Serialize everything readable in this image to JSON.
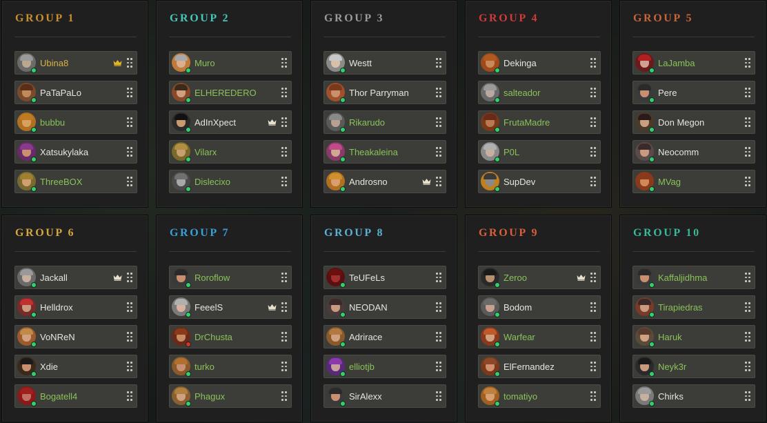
{
  "colors": {
    "owner": "#d4a640",
    "member": "#8ac25a",
    "other": "#e6e6e0",
    "online": "#2fd36d",
    "offline": "#d8322b",
    "crown": "#e6d8a8"
  },
  "groups": [
    {
      "title": "GROUP 1",
      "color": "#c98f2e",
      "players": [
        {
          "name": "Ubina8",
          "nameColor": "#d9b24a",
          "crown": true,
          "crownColor": "#e3b52a",
          "status": "online",
          "skin": "#b8a890",
          "hair": "#9a9a9a",
          "bg": "#6b6b6b"
        },
        {
          "name": "PaTaPaLo",
          "nameColor": "#e6e6e0",
          "crown": false,
          "status": "online",
          "skin": "#c08a5a",
          "hair": "#5a2f1a",
          "bg": "#7a4a2a"
        },
        {
          "name": "bubbu",
          "nameColor": "#8ac25a",
          "crown": false,
          "status": "online",
          "skin": "#d8a060",
          "hair": "#c07a20",
          "bg": "#b07020"
        },
        {
          "name": "Xatsukylaka",
          "nameColor": "#e6e6e0",
          "crown": false,
          "status": "online",
          "skin": "#c89070",
          "hair": "#8a3a8a",
          "bg": "#6a2a6a"
        },
        {
          "name": "ThreeBOX",
          "nameColor": "#8ac25a",
          "crown": false,
          "status": "online",
          "skin": "#d0a070",
          "hair": "#a08030",
          "bg": "#7a6a30"
        }
      ]
    },
    {
      "title": "GROUP 2",
      "color": "#47c7b8",
      "players": [
        {
          "name": "Muro",
          "nameColor": "#8ac25a",
          "crown": false,
          "status": "online",
          "skin": "#d8b090",
          "hair": "#a8a8a8",
          "bg": "#c07a3a"
        },
        {
          "name": "ELHEREDERO",
          "nameColor": "#8ac25a",
          "crown": false,
          "status": "online",
          "skin": "#d0a080",
          "hair": "#3a2a1a",
          "bg": "#8a4a2a"
        },
        {
          "name": "AdInXpect",
          "nameColor": "#e6e6e0",
          "crown": true,
          "crownColor": "#e6e0cc",
          "status": "online",
          "skin": "#c89a70",
          "hair": "#111111",
          "bg": "#2a2a2a"
        },
        {
          "name": "Vilarx",
          "nameColor": "#8ac25a",
          "crown": false,
          "status": "online",
          "skin": "#c8a070",
          "hair": "#b09040",
          "bg": "#7a6a2a"
        },
        {
          "name": "Dislecixo",
          "nameColor": "#8ac25a",
          "crown": false,
          "status": "online",
          "skin": "#a8a8a8",
          "hair": "#707070",
          "bg": "#4a4a4a"
        }
      ]
    },
    {
      "title": "GROUP 3",
      "color": "#9a9a96",
      "players": [
        {
          "name": "Westt",
          "nameColor": "#e6e6e0",
          "crown": false,
          "status": "online",
          "skin": "#d8c0a8",
          "hair": "#c8c8c8",
          "bg": "#8a8a8a"
        },
        {
          "name": "Thor Parryman",
          "nameColor": "#e6e6e0",
          "crown": false,
          "status": "online",
          "skin": "#c89070",
          "hair": "#7a3a1a",
          "bg": "#a0502a"
        },
        {
          "name": "Rikarudo",
          "nameColor": "#8ac25a",
          "crown": false,
          "status": "online",
          "skin": "#b8a090",
          "hair": "#8a8a8a",
          "bg": "#5a5a5a"
        },
        {
          "name": "Theakaleina",
          "nameColor": "#8ac25a",
          "crown": false,
          "status": "online",
          "skin": "#d0a890",
          "hair": "#c04a8a",
          "bg": "#8a3a6a"
        },
        {
          "name": "Androsno",
          "nameColor": "#e6e6e0",
          "crown": true,
          "crownColor": "#e6e0cc",
          "status": "online",
          "skin": "#d8a070",
          "hair": "#d09030",
          "bg": "#b07020"
        }
      ]
    },
    {
      "title": "GROUP 4",
      "color": "#d13a3a",
      "players": [
        {
          "name": "Dekinga",
          "nameColor": "#e6e6e0",
          "crown": false,
          "status": "online",
          "skin": "#c88a5a",
          "hair": "#b05a20",
          "bg": "#a04a1a"
        },
        {
          "name": "salteador",
          "nameColor": "#8ac25a",
          "crown": false,
          "status": "online",
          "skin": "#b8a8a0",
          "hair": "#9a9a9a",
          "bg": "#6a6a6a"
        },
        {
          "name": "FrutaMadre",
          "nameColor": "#8ac25a",
          "crown": false,
          "status": "online",
          "skin": "#b87a50",
          "hair": "#6a2a1a",
          "bg": "#7a3a1a"
        },
        {
          "name": "P0L",
          "nameColor": "#8ac25a",
          "crown": false,
          "status": "online",
          "skin": "#c8b0a0",
          "hair": "#b0b0b0",
          "bg": "#8a8a8a"
        },
        {
          "name": "SupDev",
          "nameColor": "#e6e6e0",
          "crown": false,
          "status": "online",
          "skin": "#8a8a8a",
          "hair": "#3a3a3a",
          "bg": "#c08020"
        }
      ]
    },
    {
      "title": "GROUP 5",
      "color": "#c8643a",
      "players": [
        {
          "name": "LaJamba",
          "nameColor": "#8ac25a",
          "crown": false,
          "status": "online",
          "skin": "#d0a090",
          "hair": "#b02020",
          "bg": "#6a1a1a"
        },
        {
          "name": "Pere",
          "nameColor": "#e6e6e0",
          "crown": false,
          "status": "online",
          "skin": "#c89070",
          "hair": "#2a2a2a",
          "bg": "#3a3a3a"
        },
        {
          "name": "Don Megon",
          "nameColor": "#e6e6e0",
          "crown": false,
          "status": "online",
          "skin": "#c8a080",
          "hair": "#2a1a1a",
          "bg": "#4a3a2a"
        },
        {
          "name": "Neocomm",
          "nameColor": "#e6e6e0",
          "crown": false,
          "status": "online",
          "skin": "#c89a80",
          "hair": "#3a2a2a",
          "bg": "#5a4a4a"
        },
        {
          "name": "MVag",
          "nameColor": "#8ac25a",
          "crown": false,
          "status": "online",
          "skin": "#d08a5a",
          "hair": "#8a3a1a",
          "bg": "#8a3a1a"
        }
      ]
    },
    {
      "title": "GROUP 6",
      "color": "#d4a640",
      "players": [
        {
          "name": "Jackall",
          "nameColor": "#e6e6e0",
          "crown": true,
          "crownColor": "#e6e0cc",
          "status": "online",
          "skin": "#c8b0a0",
          "hair": "#9a9a9a",
          "bg": "#6a6a6a"
        },
        {
          "name": "Helldrox",
          "nameColor": "#e6e6e0",
          "crown": false,
          "status": "online",
          "skin": "#c89a80",
          "hair": "#c03030",
          "bg": "#7a2a2a"
        },
        {
          "name": "VoNReN",
          "nameColor": "#e6e6e0",
          "crown": false,
          "status": "online",
          "skin": "#d0a080",
          "hair": "#c08a4a",
          "bg": "#9a5a2a"
        },
        {
          "name": "Xdie",
          "nameColor": "#e6e6e0",
          "crown": false,
          "status": "online",
          "skin": "#c89070",
          "hair": "#1a1a1a",
          "bg": "#3a2a1a"
        },
        {
          "name": "Bogatell4",
          "nameColor": "#8ac25a",
          "crown": false,
          "status": "online",
          "skin": "#c07060",
          "hair": "#a02020",
          "bg": "#8a1a1a"
        }
      ]
    },
    {
      "title": "GROUP 7",
      "color": "#3aa0d8",
      "players": [
        {
          "name": "Roroflow",
          "nameColor": "#8ac25a",
          "crown": false,
          "status": "online",
          "skin": "#c89070",
          "hair": "#2a2a2a",
          "bg": "#3a3a3a"
        },
        {
          "name": "FeeelS",
          "nameColor": "#e6e6e0",
          "crown": true,
          "crownColor": "#e6e0cc",
          "status": "online",
          "skin": "#d8b0a0",
          "hair": "#b0b0b0",
          "bg": "#7a7a7a"
        },
        {
          "name": "DrChusta",
          "nameColor": "#8ac25a",
          "crown": false,
          "status": "offline",
          "skin": "#c88a60",
          "hair": "#8a3a1a",
          "bg": "#6a2a1a"
        },
        {
          "name": "turko",
          "nameColor": "#8ac25a",
          "crown": false,
          "status": "online",
          "skin": "#c89070",
          "hair": "#b07030",
          "bg": "#8a5a2a"
        },
        {
          "name": "Phagux",
          "nameColor": "#8ac25a",
          "crown": false,
          "status": "online",
          "skin": "#d0a080",
          "hair": "#b08040",
          "bg": "#8a6030"
        }
      ]
    },
    {
      "title": "GROUP 8",
      "color": "#5ab0d0",
      "players": [
        {
          "name": "TeUFeLs",
          "nameColor": "#e6e6e0",
          "crown": false,
          "status": "online",
          "skin": "#a03030",
          "hair": "#6a1010",
          "bg": "#5a1010"
        },
        {
          "name": "NEODAN",
          "nameColor": "#e6e6e0",
          "crown": false,
          "status": "online",
          "skin": "#c89a80",
          "hair": "#3a2a2a",
          "bg": "#4a3a3a"
        },
        {
          "name": "Adrirace",
          "nameColor": "#e6e6e0",
          "crown": false,
          "status": "online",
          "skin": "#d0a080",
          "hair": "#b07a40",
          "bg": "#8a5a2a"
        },
        {
          "name": "elliotjb",
          "nameColor": "#8ac25a",
          "crown": false,
          "status": "online",
          "skin": "#c8a0a0",
          "hair": "#8a3aaa",
          "bg": "#5a2a7a"
        },
        {
          "name": "SirAlexx",
          "nameColor": "#e6e6e0",
          "crown": false,
          "status": "online",
          "skin": "#c89070",
          "hair": "#2a2a2a",
          "bg": "#3a3a3a"
        }
      ]
    },
    {
      "title": "GROUP 9",
      "color": "#d8603a",
      "players": [
        {
          "name": "Zeroo",
          "nameColor": "#8ac25a",
          "crown": true,
          "crownColor": "#e6e0cc",
          "status": "online",
          "skin": "#b89070",
          "hair": "#1a1a1a",
          "bg": "#2a2a2a"
        },
        {
          "name": "Bodom",
          "nameColor": "#e6e6e0",
          "crown": false,
          "status": "online",
          "skin": "#c8a090",
          "hair": "#6a6a6a",
          "bg": "#5a5a5a"
        },
        {
          "name": "Warfear",
          "nameColor": "#8ac25a",
          "crown": false,
          "status": "online",
          "skin": "#d0a080",
          "hair": "#c05a2a",
          "bg": "#8a3a1a"
        },
        {
          "name": "ElFernandez",
          "nameColor": "#e6e6e0",
          "crown": false,
          "status": "online",
          "skin": "#d09070",
          "hair": "#8a4a2a",
          "bg": "#7a3a1a"
        },
        {
          "name": "tomatiyo",
          "nameColor": "#8ac25a",
          "crown": false,
          "status": "online",
          "skin": "#d8a070",
          "hair": "#c08040",
          "bg": "#a06020"
        }
      ]
    },
    {
      "title": "GROUP 10",
      "color": "#3ab89a",
      "players": [
        {
          "name": "Kaffaljidhma",
          "nameColor": "#8ac25a",
          "crown": false,
          "status": "online",
          "skin": "#c89070",
          "hair": "#2a2a2a",
          "bg": "#3a3a3a"
        },
        {
          "name": "Tirapiedras",
          "nameColor": "#8ac25a",
          "crown": false,
          "status": "online",
          "skin": "#c89a80",
          "hair": "#3a2a2a",
          "bg": "#7a3a2a"
        },
        {
          "name": "Haruk",
          "nameColor": "#8ac25a",
          "crown": false,
          "status": "online",
          "skin": "#d0a080",
          "hair": "#5a3a2a",
          "bg": "#5a4a3a"
        },
        {
          "name": "Neyk3r",
          "nameColor": "#8ac25a",
          "crown": false,
          "status": "online",
          "skin": "#c89a80",
          "hair": "#1a1a1a",
          "bg": "#2a2a2a"
        },
        {
          "name": "Chirks",
          "nameColor": "#e6e6e0",
          "crown": false,
          "status": "online",
          "skin": "#c8b0a0",
          "hair": "#9a9a9a",
          "bg": "#7a7a7a"
        }
      ]
    }
  ]
}
